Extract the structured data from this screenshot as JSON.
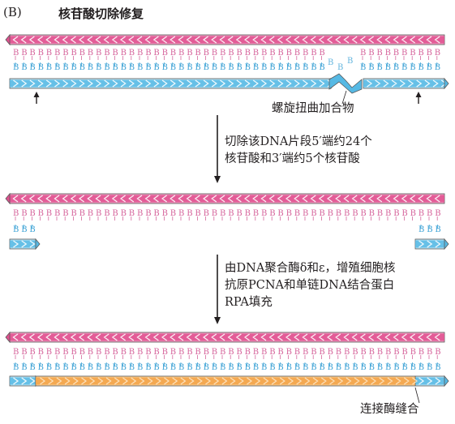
{
  "header": {
    "part_label": "(B)",
    "title": "核苷酸切除修复"
  },
  "step1": {
    "annotation": "螺旋扭曲加合物"
  },
  "arrow1_text": {
    "line1": "切除该DNA片段5′端约24个",
    "line2": "核苷酸和3′端约5个核苷酸"
  },
  "arrow2_text": {
    "line1": "由DNA聚合酶δ和ε，增殖细胞核",
    "line2": "抗原PCNA和单链DNA结合蛋白",
    "line3": "RPA填充"
  },
  "step3": {
    "annotation": "连接酶缝合"
  },
  "base_letter": "B",
  "colors": {
    "top_strand": "#e0508e",
    "top_strand_light": "#f0a2c5",
    "bottom_strand": "#56b9e4",
    "bottom_strand_light": "#bfe6f6",
    "new_strand": "#f3a44a",
    "new_strand_light": "#f9cf94",
    "base_pink": "#d6659c",
    "base_blue": "#3ea3d6",
    "outline": "#5a5a5a"
  }
}
